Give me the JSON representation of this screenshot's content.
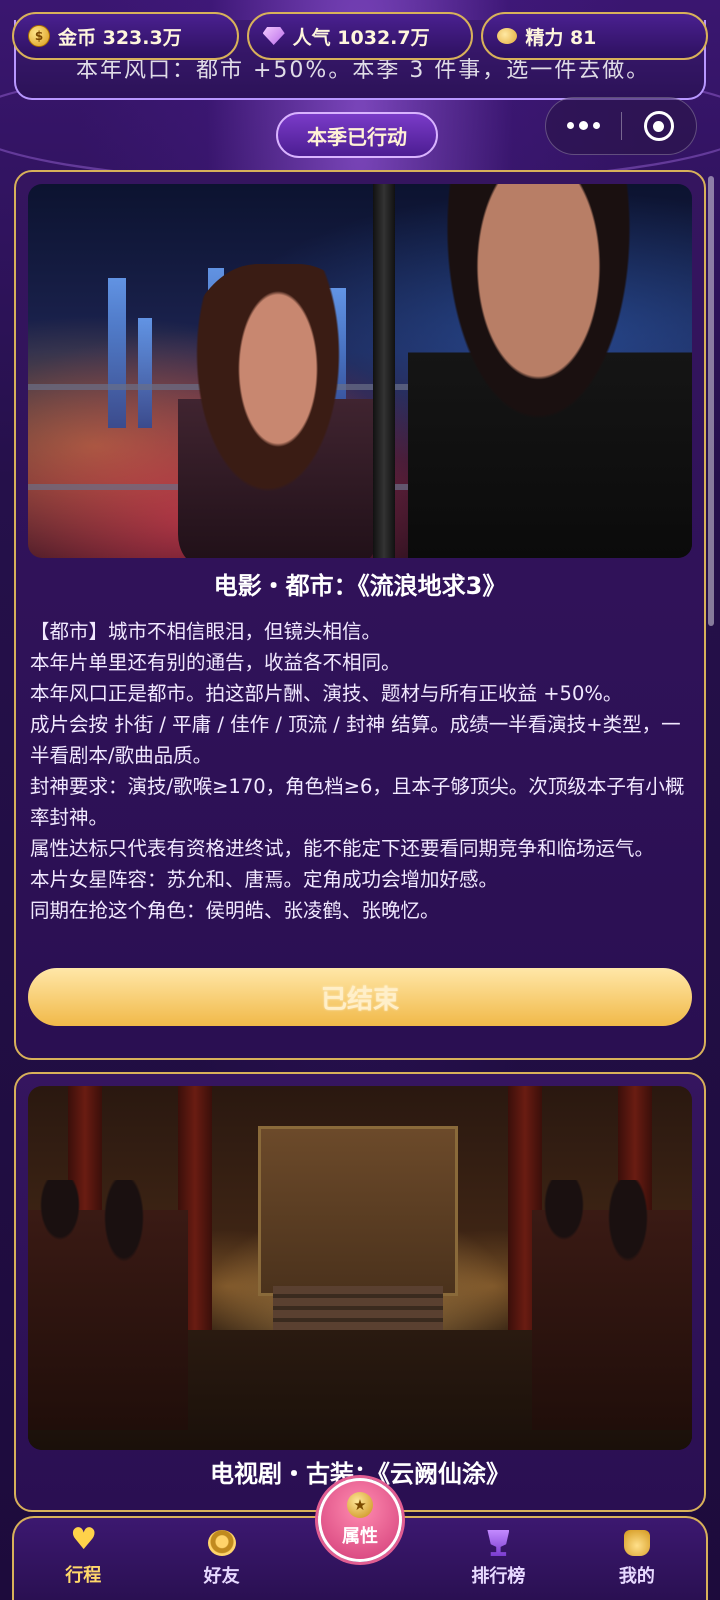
{
  "stats": {
    "gold": {
      "label": "金币 323.3万",
      "icon": "gold-coin-icon"
    },
    "popularity": {
      "label": "人气 1032.7万",
      "icon": "diamond-icon"
    },
    "energy": {
      "label": "精力 81",
      "icon": "energy-icon"
    }
  },
  "previous_card": {
    "partial_text": "本年风口：都市 +50%。本季 3 件事，选一件去做。"
  },
  "season_status": "本季已行动",
  "cards": [
    {
      "title": "电影・都市：《流浪地求3》",
      "description": [
        "【都市】城市不相信眼泪，但镜头相信。",
        "本年片单里还有别的通告，收益各不相同。",
        "本年风口正是都市。拍这部片酬、演技、题材与所有正收益 +50%。",
        "成片会按 扑街 / 平庸 / 佳作 / 顶流 / 封神 结算。成绩一半看演技+类型，一半看剧本/歌曲品质。",
        "封神要求：演技/歌喉≥170，角色档≥6，且本子够顶尖。次顶级本子有小概率封神。",
        "属性达标只代表有资格进终试，能不能定下还要看同期竞争和临场运气。",
        "本片女星阵容：苏允和、唐焉。定角成功会增加好感。",
        "同期在抢这个角色：侯明皓、张凌鹤、张晚忆。"
      ],
      "button_label": "已结束"
    },
    {
      "title": "电视剧・古装：《云阙仙涂》"
    }
  ],
  "bottom_nav": {
    "items": [
      {
        "label": "行程",
        "icon": "heart-icon"
      },
      {
        "label": "好友",
        "icon": "friends-icon"
      },
      {
        "label": "属性",
        "icon": "star-medal-icon"
      },
      {
        "label": "排行榜",
        "icon": "trophy-icon"
      },
      {
        "label": "我的",
        "icon": "backpack-icon"
      }
    ],
    "active": "行程"
  },
  "colors": {
    "gold_border": "#d8b15a",
    "background": "#2a0f52",
    "button_gradient_top": "#ffe7a8",
    "button_gradient_bottom": "#f1b949",
    "center_button": "#d23c78"
  }
}
